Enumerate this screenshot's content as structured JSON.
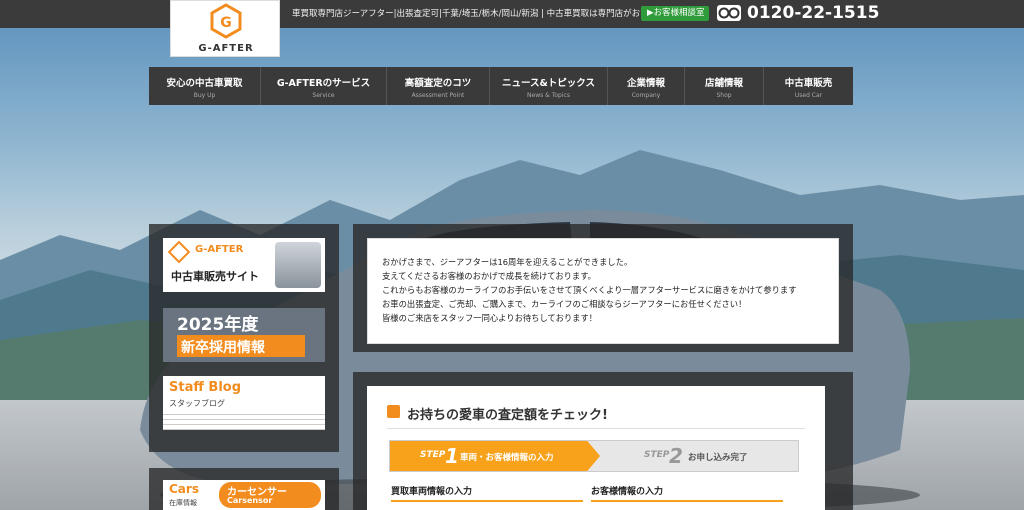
{
  "header": {
    "tagline": "車買取専門店ジーアフター|出張査定可|千葉/埼玉/栃木/岡山/新潟 | 中古車買取は専門店がおすすめ",
    "logo_text": "G-AFTER",
    "consult_button": "お客様相談室",
    "phone_icon": "freedial-icon",
    "phone": "0120-22-1515"
  },
  "nav": [
    {
      "label": "安心の中古車買取",
      "sub": "Buy Up"
    },
    {
      "label": "G-AFTERのサービス",
      "sub": "Service"
    },
    {
      "label": "高額査定のコツ",
      "sub": "Assessment Point"
    },
    {
      "label": "ニュース&トピックス",
      "sub": "News & Topics"
    },
    {
      "label": "企業情報",
      "sub": "Company"
    },
    {
      "label": "店舗情報",
      "sub": "Shop"
    },
    {
      "label": "中古車販売",
      "sub": "Used Car"
    }
  ],
  "sidebar": {
    "banner1": {
      "brand": "G-AFTER",
      "label": "中古車販売サイト"
    },
    "banner2": {
      "line1": "2025年度",
      "line2": "新卒採用情報"
    },
    "banner3": {
      "title": "Staff Blog",
      "sub": "スタッフブログ"
    },
    "banner4": {
      "title": "Cars",
      "sub": "在庫情報",
      "brand": "カーセンサー",
      "brand_en": "Carsensor"
    }
  },
  "greeting": {
    "lines": [
      "おかげさまで、ジーアフターは16周年を迎えることができました。",
      "支えてくださるお客様のおかげで成長を続けております。",
      "これからもお客様のカーライフのお手伝いをさせて頂くべくより一層アフターサービスに磨きをかけて参ります",
      "お車の出張査定、ご売却、ご購入まで、カーライフのご相談ならジーアフターにお任せください！",
      "皆様のご来店をスタッフ一同心よりお待ちしております！"
    ]
  },
  "form": {
    "title": "お持ちの愛車の査定額をチェック!",
    "step1_tag": "STEP",
    "step1_num": "1",
    "step1_label": "車両・お客様情報の入力",
    "step2_tag": "STEP",
    "step2_num": "2",
    "step2_label": "お申し込み完了",
    "section_vehicle": "買取車両情報の入力",
    "section_customer": "お客様情報の入力"
  },
  "colors": {
    "accent": "#f7a21a",
    "nav_bg": "#3a3a3a",
    "topbar": "#3b3b3b",
    "consult": "#2f9b3a"
  }
}
